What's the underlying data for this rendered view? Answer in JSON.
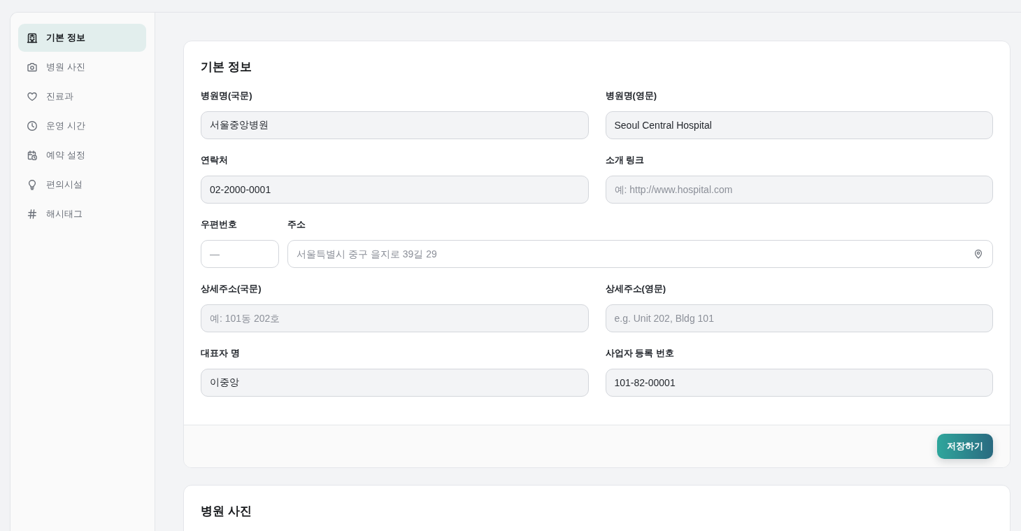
{
  "sidebar": {
    "items": [
      {
        "label": "기본 정보",
        "selected": true
      },
      {
        "label": "병원 사진",
        "selected": false
      },
      {
        "label": "진료과",
        "selected": false
      },
      {
        "label": "운영 시간",
        "selected": false
      },
      {
        "label": "예약 설정",
        "selected": false
      },
      {
        "label": "편의시설",
        "selected": false
      },
      {
        "label": "해시태그",
        "selected": false
      }
    ]
  },
  "sections": [
    {
      "title": "기본 정보",
      "rows": [
        [
          {
            "kind": "text",
            "label": "병원명(국문)",
            "value": "서울중앙병원"
          },
          {
            "kind": "text",
            "label": "병원명(영문)",
            "value": "Seoul Central Hospital"
          }
        ],
        [
          {
            "kind": "text",
            "label": "연락처",
            "value": "02-2000-0001"
          },
          {
            "kind": "text",
            "label": "소개 링크",
            "placeholder": "예: http://www.hospital.com"
          }
        ],
        [
          {
            "kind": "zip",
            "label": "우편번호",
            "placeholder": "—"
          },
          {
            "kind": "address",
            "label": "주소",
            "placeholder": "서울특별시 중구 을지로 39길 29"
          }
        ],
        [
          {
            "kind": "text",
            "label": "상세주소(국문)",
            "placeholder": "예: 101동 202호"
          },
          {
            "kind": "text",
            "label": "상세주소(영문)",
            "placeholder": "e.g. Unit 202, Bldg 101"
          }
        ],
        [
          {
            "kind": "text",
            "label": "대표자 명",
            "value": "이중앙"
          },
          {
            "kind": "text",
            "label": "사업자 등록 번호",
            "value": "101-82-00001"
          }
        ]
      ],
      "save_button": "저장하기"
    },
    {
      "title": "병원 사진"
    }
  ]
}
